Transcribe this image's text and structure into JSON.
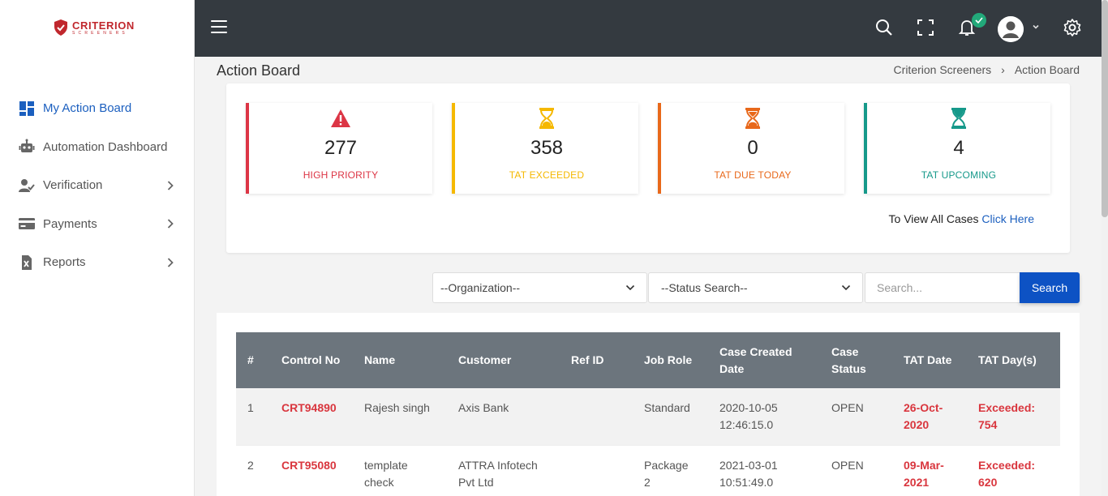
{
  "brand": {
    "name": "CRITERION",
    "tagline": "SCREENERS",
    "color": "#c0272d"
  },
  "sidebar": {
    "items": [
      {
        "label": "My Action Board",
        "icon": "dashboard-grid-icon",
        "active": true,
        "has_submenu": false
      },
      {
        "label": "Automation Dashboard",
        "icon": "robot-icon",
        "active": false,
        "has_submenu": false
      },
      {
        "label": "Verification",
        "icon": "user-check-icon",
        "active": false,
        "has_submenu": true
      },
      {
        "label": "Payments",
        "icon": "credit-card-icon",
        "active": false,
        "has_submenu": true
      },
      {
        "label": "Reports",
        "icon": "excel-file-icon",
        "active": false,
        "has_submenu": true
      }
    ]
  },
  "topbar": {
    "icons": [
      "menu-icon",
      "search-icon",
      "fullscreen-icon",
      "bell-icon",
      "avatar",
      "gear-icon"
    ],
    "background": "#343a40"
  },
  "page": {
    "title": "Action Board"
  },
  "breadcrumb": {
    "parent": "Criterion Screeners",
    "separator": "›",
    "current": "Action Board"
  },
  "stats": [
    {
      "value": "277",
      "label": "HIGH PRIORITY",
      "color": "#dc3545",
      "icon": "warning-triangle-icon"
    },
    {
      "value": "358",
      "label": "TAT EXCEEDED",
      "color": "#f5b800",
      "icon": "hourglass-icon"
    },
    {
      "value": "0",
      "label": "TAT DUE TODAY",
      "color": "#e8681a",
      "icon": "hourglass-icon"
    },
    {
      "value": "4",
      "label": "TAT UPCOMING",
      "color": "#16998a",
      "icon": "hourglass-icon"
    }
  ],
  "view_all": {
    "text": "To View All Cases",
    "link": "Click Here"
  },
  "filters": {
    "organization": "--Organization--",
    "status": "--Status Search--",
    "search_placeholder": "Search...",
    "search_button": "Search"
  },
  "table": {
    "headers": [
      "#",
      "Control No",
      "Name",
      "Customer",
      "Ref ID",
      "Job Role",
      "Case Created Date",
      "Case Status",
      "TAT Date",
      "TAT Day(s)"
    ],
    "rows": [
      {
        "num": "1",
        "control_no": "CRT94890",
        "name": "Rajesh singh",
        "customer": "Axis Bank",
        "ref_id": "",
        "job_role": "Standard",
        "created": "2020-10-05 12:46:15.0",
        "status": "OPEN",
        "tat_date": "26-Oct-2020",
        "tat_days": "Exceeded: 754"
      },
      {
        "num": "2",
        "control_no": "CRT95080",
        "name": "template check",
        "customer": "ATTRA Infotech Pvt Ltd",
        "ref_id": "",
        "job_role": "Package 2",
        "created": "2021-03-01 10:51:49.0",
        "status": "OPEN",
        "tat_date": "09-Mar-2021",
        "tat_days": "Exceeded: 620"
      }
    ]
  }
}
